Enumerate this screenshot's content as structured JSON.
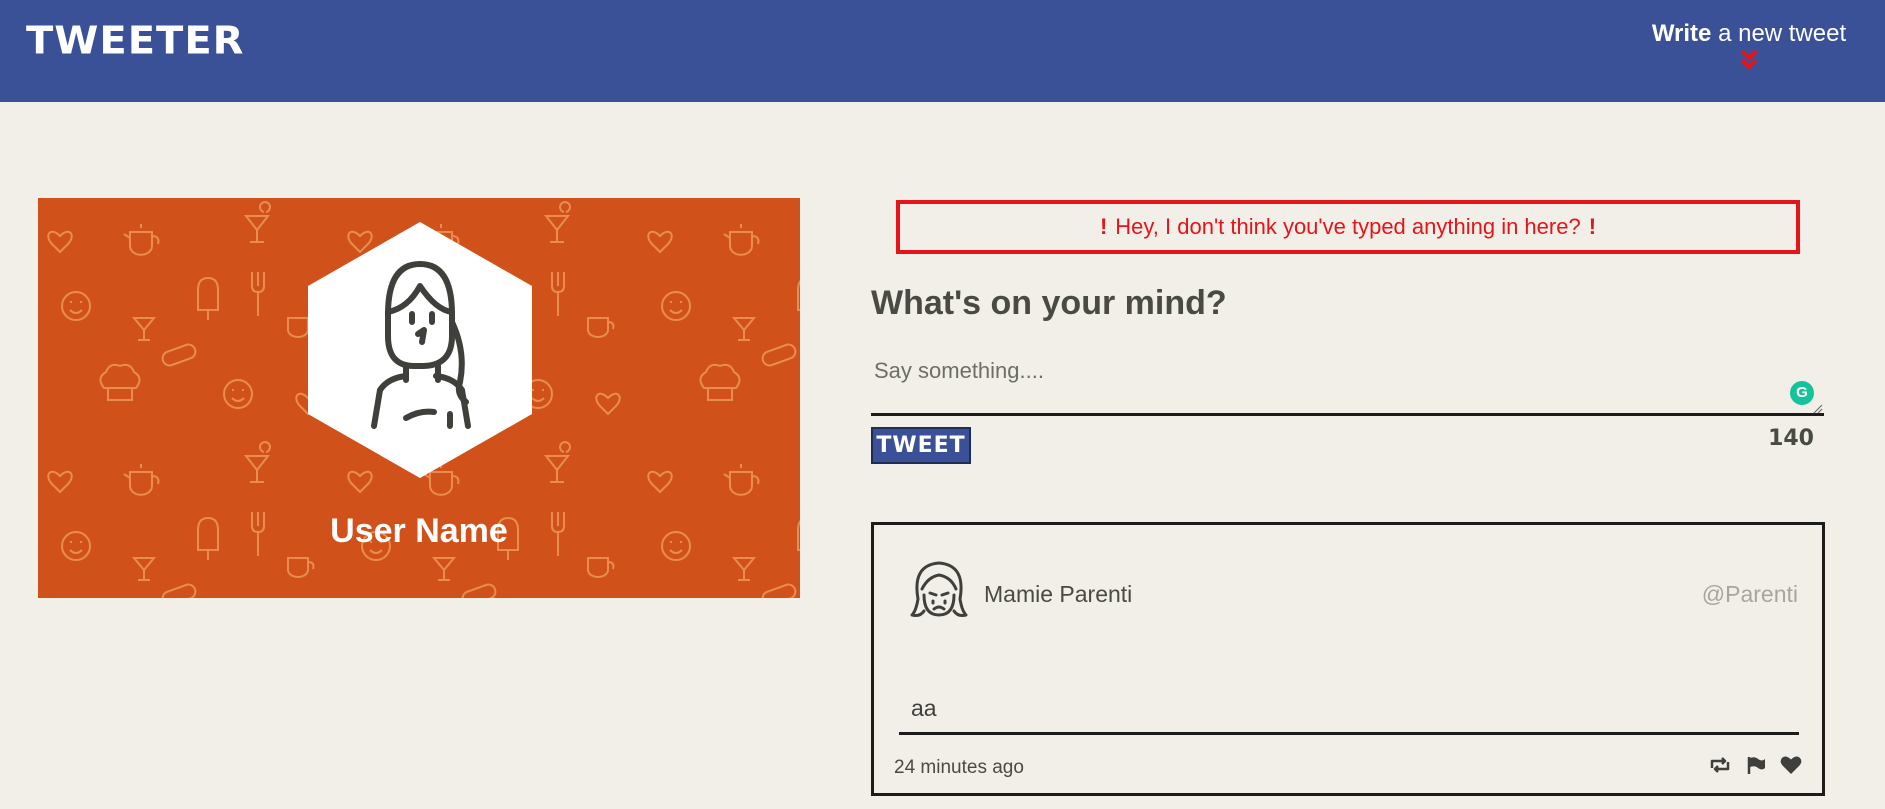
{
  "nav": {
    "brand": "TWEETER",
    "compose_bold": "Write",
    "compose_rest": " a new tweet"
  },
  "profile": {
    "name": "User Name"
  },
  "composer": {
    "error_message": "Hey, I don't think you've typed anything in here?",
    "heading": "What's on your mind?",
    "placeholder": "Say something....",
    "input_value": "",
    "submit_label": "TWEET",
    "char_count": "140"
  },
  "tweets": [
    {
      "author": "Mamie Parenti",
      "handle": "@Parenti",
      "content": "aa",
      "timestamp": "24 minutes ago"
    }
  ],
  "colors": {
    "nav": "#3a5097",
    "profile_bg": "#d0521a",
    "error": "#e5141a",
    "background": "#f1efe8"
  },
  "icons": {
    "compose": "chevron-double-down-icon",
    "retweet": "retweet-icon",
    "flag": "flag-icon",
    "like": "heart-icon"
  }
}
